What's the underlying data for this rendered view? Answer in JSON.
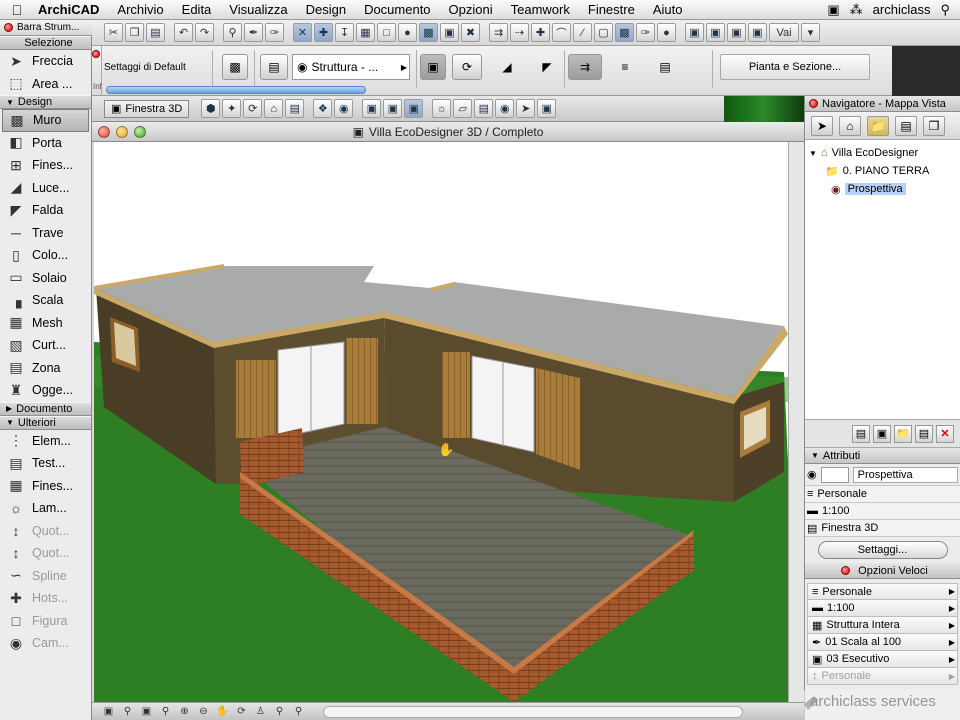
{
  "menubar": {
    "app_name": "ArchiCAD",
    "items": [
      "Archivio",
      "Edita",
      "Visualizza",
      "Design",
      "Documento",
      "Opzioni",
      "Teamwork",
      "Finestre",
      "Aiuto"
    ],
    "user": "archiclass"
  },
  "toolbox": {
    "title": "Barra Strum...",
    "header": "Selezione",
    "selection_tools": [
      {
        "label": "Freccia"
      },
      {
        "label": "Area ..."
      }
    ],
    "design_section": "Design",
    "design_tools": [
      {
        "label": "Muro",
        "selected": true
      },
      {
        "label": "Porta"
      },
      {
        "label": "Fines..."
      },
      {
        "label": "Luce..."
      },
      {
        "label": "Falda"
      },
      {
        "label": "Trave"
      },
      {
        "label": "Colo..."
      },
      {
        "label": "Solaio"
      },
      {
        "label": "Scala"
      },
      {
        "label": "Mesh"
      },
      {
        "label": "Curt..."
      },
      {
        "label": "Zona"
      },
      {
        "label": "Ogge..."
      }
    ],
    "document_section": "Documento",
    "more_section": "Ulteriori",
    "more_tools": [
      {
        "label": "Elem..."
      },
      {
        "label": "Test..."
      },
      {
        "label": "Fines..."
      },
      {
        "label": "Lam..."
      },
      {
        "label": "Quot...",
        "dim": true
      },
      {
        "label": "Quot...",
        "dim": true
      },
      {
        "label": "Spline",
        "dim": true
      },
      {
        "label": "Hots...",
        "dim": true
      },
      {
        "label": "Figura",
        "dim": true
      },
      {
        "label": "Cam...",
        "dim": true
      }
    ]
  },
  "infobox": {
    "side_label": "Inf",
    "default_settings": "Settaggi di Default",
    "structure_value": "Struttura - ...",
    "plan_section_button": "Pianta e Sezione..."
  },
  "window3d": {
    "tab": "Finestra 3D",
    "title": "Villa EcoDesigner 3D / Completo"
  },
  "navigator": {
    "title": "Navigatore - Mappa Vista",
    "tree": [
      {
        "label": "Villa EcoDesigner",
        "level": 0
      },
      {
        "label": "0. PIANO TERRA",
        "level": 1
      },
      {
        "label": "Prospettiva",
        "level": 1,
        "selected": true
      }
    ]
  },
  "attributes": {
    "header": "Attributi",
    "name_value": "Prospettiva",
    "rows": [
      "Personale",
      "1:100",
      "Finestra 3D"
    ],
    "settings_button": "Settaggi..."
  },
  "quick_options": {
    "header": "Opzioni Veloci",
    "rows": [
      {
        "label": "Personale"
      },
      {
        "label": "1:100"
      },
      {
        "label": "Struttura Intera"
      },
      {
        "label": "01 Scala al 100"
      },
      {
        "label": "03 Esecutivo"
      },
      {
        "label": "Personale",
        "dim": true
      }
    ]
  },
  "watermark": "archiclass services",
  "colors": {
    "grass": "#2e7f23",
    "wall": "#5f4f31",
    "roof": "#a9aaaa",
    "brick": "#a0522d",
    "selection": "#b8d0f4"
  }
}
